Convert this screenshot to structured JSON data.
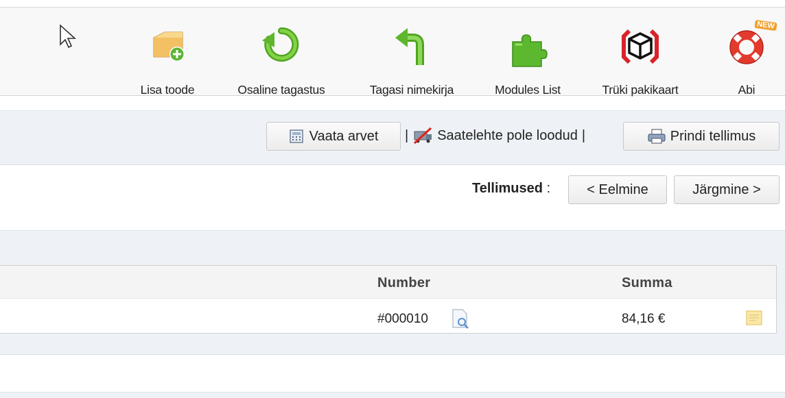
{
  "toolbar": {
    "items": [
      {
        "label": "Lisa toode",
        "icon": "add-product-icon"
      },
      {
        "label": "Osaline tagastus",
        "icon": "partial-refund-icon"
      },
      {
        "label": "Tagasi nimekirja",
        "icon": "back-arrow-icon"
      },
      {
        "label": "Modules List",
        "icon": "puzzle-icon"
      },
      {
        "label": "Trüki pakikaart",
        "icon": "package-icon"
      },
      {
        "label": "Abi",
        "icon": "lifebuoy-icon",
        "badge": "NEW"
      }
    ]
  },
  "actions": {
    "view_invoice": "Vaata arvet",
    "separator": "|",
    "delivery_slip_status": "Saatelehte pole loodud",
    "print_order": "Prindi tellimus"
  },
  "order_nav": {
    "label": "Tellimused",
    "colon": ":",
    "previous": "< Eelmine",
    "next": "Järgmine >"
  },
  "table": {
    "headers": {
      "number": "Number",
      "total": "Summa"
    },
    "rows": [
      {
        "number": "#000010",
        "total": "84,16 €"
      }
    ]
  },
  "colors": {
    "toolbar_bg": "#f8f8f8",
    "section_bg": "#eef2f6",
    "green": "#6cbf2a",
    "red": "#d9232a"
  }
}
